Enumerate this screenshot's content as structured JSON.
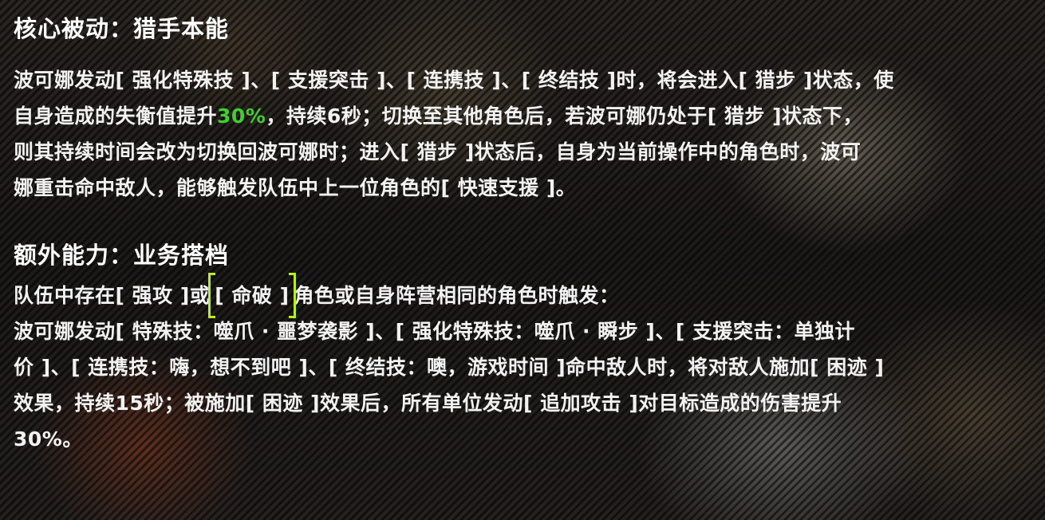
{
  "colors": {
    "highlight": "#3fcf2f",
    "selection_bracket": "#b9ef1a",
    "text": "#f2f2f2"
  },
  "section1": {
    "title": "核心被动：猎手本能",
    "line1": "波可娜发动[ 强化特殊技 ]、[ 支援突击 ]、[ 连携技 ]、[ 终结技 ]时，将会进入[ 猎步 ]状态，使",
    "line2_pre": "自身造成的失衡值提升",
    "line2_hl": "30%",
    "line2_post": "，持续6秒；切换至其他角色后，若波可娜仍处于[ 猎步 ]状态下，",
    "line3": "则其持续时间会改为切换回波可娜时；进入[ 猎步 ]状态后，自身为当前操作中的角色时，波可",
    "line4": "娜重击命中敌人，能够触发队伍中上一位角色的[ 快速支援 ]。"
  },
  "section2": {
    "title": "额外能力：业务搭档",
    "line1_pre": "队伍中存在[ 强攻 ]或",
    "line1_selected": "[ 命破 ]",
    "line1_post": "角色或自身阵营相同的角色时触发：",
    "line2": "波可娜发动[ 特殊技：噬爪 · 噩梦袭影 ]、[ 强化特殊技：噬爪 · 瞬步 ]、[ 支援突击：单独计",
    "line3": "价 ]、[ 连携技：嗨，想不到吧 ]、[ 终结技：噢，游戏时间 ]命中敌人时，将对敌人施加[ 困迹 ]",
    "line4": "效果，持续15秒；被施加[ 困迹 ]效果后，所有单位发动[ 追加攻击 ]对目标造成的伤害提升",
    "line5": "30%。"
  }
}
